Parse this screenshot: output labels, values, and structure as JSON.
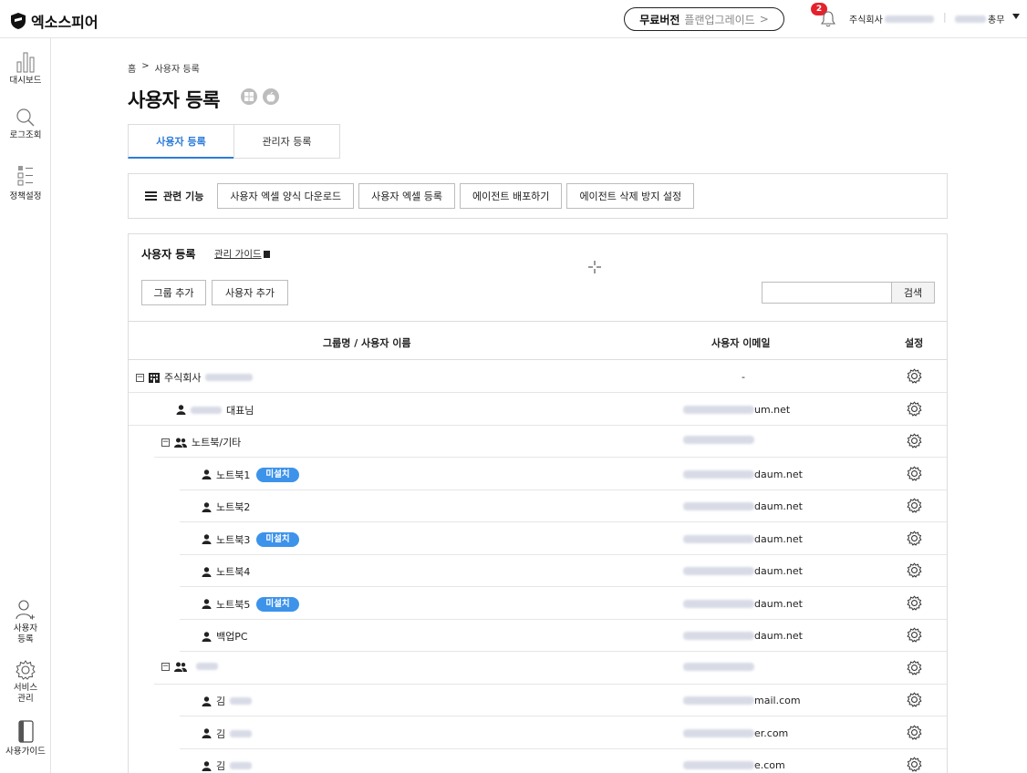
{
  "header": {
    "logo_text": "엑소스피어",
    "upgrade_bold": "무료버전",
    "upgrade_light": "플랜업그레이드",
    "upgrade_arrow": ">",
    "notification_count": "2",
    "company_prefix": "주식회사",
    "user_suffix": "총무"
  },
  "sidebar": {
    "items": [
      {
        "label": "대시보드",
        "icon": "bar-chart-icon"
      },
      {
        "label": "로그조회",
        "icon": "search-icon"
      },
      {
        "label": "정책설정",
        "icon": "policy-list-icon"
      }
    ],
    "bottom_items": [
      {
        "label_line1": "사용자",
        "label_line2": "등록",
        "icon": "add-user-icon"
      },
      {
        "label_line1": "서비스",
        "label_line2": "관리",
        "icon": "gear-icon"
      },
      {
        "label_line1": "사용가이드",
        "label_line2": "",
        "icon": "guide-book-icon"
      }
    ]
  },
  "breadcrumb": {
    "home": "홈",
    "separator": ">",
    "current": "사용자 등록"
  },
  "page": {
    "title": "사용자 등록"
  },
  "tabs": [
    {
      "label": "사용자 등록",
      "active": true
    },
    {
      "label": "관리자 등록",
      "active": false
    }
  ],
  "related": {
    "label": "관련 기능",
    "buttons": [
      "사용자 엑셀 양식 다운로드",
      "사용자 엑셀 등록",
      "에이전트 배포하기",
      "에이전트 삭제 방지 설정"
    ]
  },
  "panel": {
    "title": "사용자 등록",
    "guide_link": "관리 가이드",
    "add_group": "그룹 추가",
    "add_user": "사용자 추가",
    "search_placeholder": "",
    "search_button": "검색"
  },
  "table": {
    "columns": [
      "그룹명 / 사용자 이름",
      "사용자 이메일",
      "설정"
    ],
    "rows": [
      {
        "type": "company",
        "name": "주식회사",
        "email": "-",
        "blur_email": false
      },
      {
        "type": "user",
        "name": "대표님",
        "email": "um.net",
        "blur_email": true
      },
      {
        "type": "group",
        "name": "노트북/기타",
        "email": "",
        "blur_email": true
      },
      {
        "type": "user",
        "name": "노트북1",
        "badge": "미설치",
        "email": "daum.net",
        "blur_email": true
      },
      {
        "type": "user",
        "name": "노트북2",
        "email": "daum.net",
        "blur_email": true
      },
      {
        "type": "user",
        "name": "노트북3",
        "badge": "미설치",
        "email": "daum.net",
        "blur_email": true
      },
      {
        "type": "user",
        "name": "노트북4",
        "email": "daum.net",
        "blur_email": true
      },
      {
        "type": "user",
        "name": "노트북5",
        "badge": "미설치",
        "email": "daum.net",
        "blur_email": true
      },
      {
        "type": "user",
        "name": "백업PC",
        "email": "daum.net",
        "blur_email": true
      },
      {
        "type": "group",
        "name": "",
        "email": "",
        "blur_email": true
      },
      {
        "type": "user",
        "name": "김",
        "email": "mail.com",
        "blur_email": true
      },
      {
        "type": "user",
        "name": "김",
        "email": "er.com",
        "blur_email": true
      },
      {
        "type": "user",
        "name": "김",
        "email": "e.com",
        "blur_email": true
      }
    ]
  },
  "colors": {
    "accent": "#2c7bd9",
    "badge": "#3d93ea",
    "notification": "#e4222d"
  }
}
